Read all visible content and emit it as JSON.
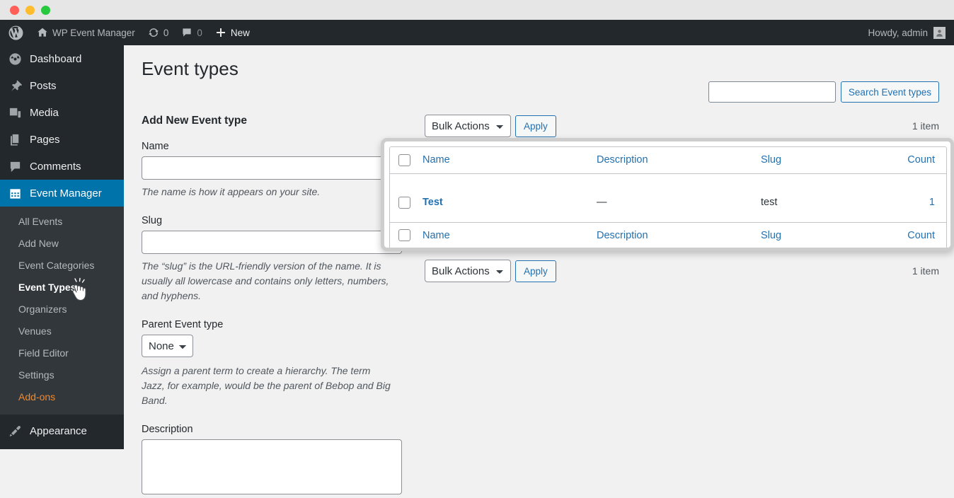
{
  "window": {
    "controls": [
      "close",
      "minimize",
      "maximize"
    ]
  },
  "adminbar": {
    "logo_icon": "wordpress-logo-icon",
    "site_icon": "home-icon",
    "site_name": "WP Event Manager",
    "updates_icon": "updates-icon",
    "updates_count": "0",
    "comments_icon": "comment-bubble-icon",
    "comments_count": "0",
    "new_icon": "plus-icon",
    "new_label": "New",
    "howdy": "Howdy, admin",
    "avatar_icon": "user-avatar-icon"
  },
  "sidebar": {
    "items": [
      {
        "label": "Dashboard",
        "icon": "dashboard-icon",
        "active": false
      },
      {
        "label": "Posts",
        "icon": "pin-icon",
        "active": false
      },
      {
        "label": "Media",
        "icon": "media-icon",
        "active": false
      },
      {
        "label": "Pages",
        "icon": "pages-icon",
        "active": false
      },
      {
        "label": "Comments",
        "icon": "comment-icon",
        "active": false
      },
      {
        "label": "Event Manager",
        "icon": "calendar-icon",
        "active": true
      }
    ],
    "submenu": [
      {
        "label": "All Events",
        "state": "normal"
      },
      {
        "label": "Add New",
        "state": "normal"
      },
      {
        "label": "Event Categories",
        "state": "normal"
      },
      {
        "label": "Event Types",
        "state": "current"
      },
      {
        "label": "Organizers",
        "state": "normal"
      },
      {
        "label": "Venues",
        "state": "normal"
      },
      {
        "label": "Field Editor",
        "state": "normal"
      },
      {
        "label": "Settings",
        "state": "normal"
      },
      {
        "label": "Add-ons",
        "state": "addons"
      }
    ],
    "appearance": {
      "label": "Appearance",
      "icon": "appearance-brush-icon"
    }
  },
  "cursor": {
    "icon": "pointing-hand-cursor-icon"
  },
  "page": {
    "title": "Event types"
  },
  "search": {
    "value": "",
    "placeholder": "",
    "button_label": "Search Event types"
  },
  "form": {
    "heading": "Add New Event type",
    "name_label": "Name",
    "name_value": "",
    "name_help": "The name is how it appears on your site.",
    "slug_label": "Slug",
    "slug_value": "",
    "slug_help": "The “slug” is the URL-friendly version of the name. It is usually all lowercase and contains only letters, numbers, and hyphens.",
    "parent_label": "Parent Event type",
    "parent_value": "None",
    "parent_options": [
      "None"
    ],
    "parent_help": "Assign a parent term to create a hierarchy. The term Jazz, for example, would be the parent of Bebop and Big Band.",
    "description_label": "Description",
    "description_value": ""
  },
  "tablenav_top": {
    "bulk_value": "Bulk Actions",
    "bulk_options": [
      "Bulk Actions"
    ],
    "apply_label": "Apply",
    "item_count": "1 item",
    "select_all_checkbox": "unchecked"
  },
  "tablenav_bottom": {
    "bulk_value": "Bulk Actions",
    "bulk_options": [
      "Bulk Actions"
    ],
    "apply_label": "Apply",
    "item_count": "1 item"
  },
  "table": {
    "columns": [
      "Name",
      "Description",
      "Slug",
      "Count"
    ],
    "rows": [
      {
        "checkbox": "unchecked",
        "name": "Test",
        "description": "—",
        "slug": "test",
        "count": "1"
      }
    ]
  },
  "colors": {
    "admin_bar": "#23282d",
    "sidebar": "#23282d",
    "submenu": "#32373c",
    "active_menu": "#0073aa",
    "link_blue": "#2271b1",
    "addons_orange": "#ed8a31",
    "content_bg": "#f1f1f1",
    "highlight_border": "#cdcdcd"
  }
}
